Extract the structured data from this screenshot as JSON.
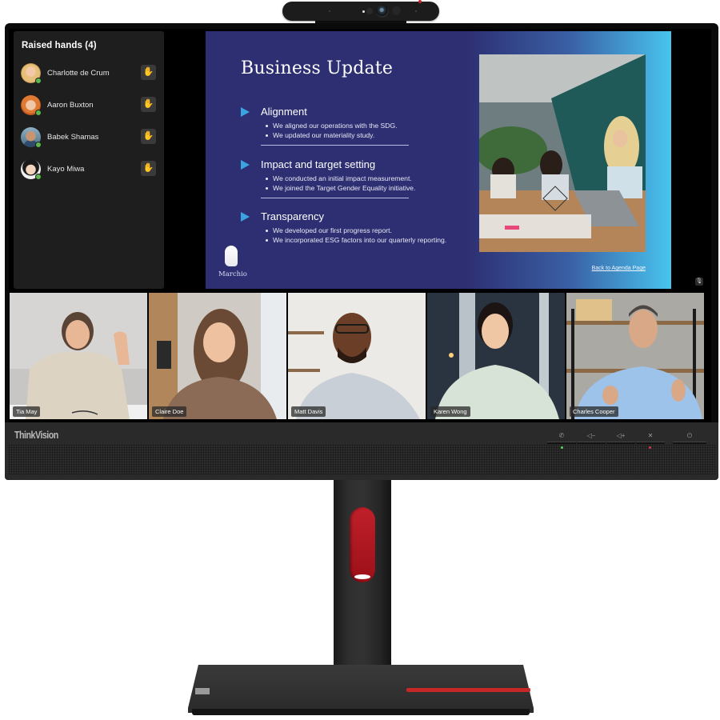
{
  "raised_hands": {
    "title": "Raised hands (4)",
    "participants": [
      {
        "name": "Charlotte de Crum",
        "status": "available",
        "icon": "raised-hand-icon"
      },
      {
        "name": "Aaron Buxton",
        "status": "available",
        "icon": "raised-hand-icon"
      },
      {
        "name": "Babek Shamas",
        "status": "available",
        "icon": "raised-hand-icon"
      },
      {
        "name": "Kayo Miwa",
        "status": "available",
        "icon": "raised-hand-icon"
      }
    ],
    "hand_glyph": "✋"
  },
  "slide": {
    "title": "Business Update",
    "sections": [
      {
        "heading": "Alignment",
        "bullets": [
          "We aligned our operations with the SDG.",
          "We updated our materiality study."
        ]
      },
      {
        "heading": "Impact and target setting",
        "bullets": [
          "We conducted an initial impact measurement.",
          "We joined the Target Gender Equality initiative."
        ]
      },
      {
        "heading": "Transparency",
        "bullets": [
          "We developed our first progress report.",
          "We incorporated ESG factors into our  quarterly reporting."
        ]
      }
    ],
    "logo_text": "Marchio",
    "link": "Back to Agenda Page",
    "colors": {
      "background": "#2d2f72",
      "gradient_end": "#48c4ef",
      "accent": "#3aa3e0"
    }
  },
  "video_tiles": [
    {
      "name": "Tia May"
    },
    {
      "name": "Claire Doe"
    },
    {
      "name": "Matt Davis"
    },
    {
      "name": "Karen Wong"
    },
    {
      "name": "Charles Cooper"
    }
  ],
  "monitor": {
    "brand": "ThinkVision",
    "controls": [
      {
        "name": "call",
        "glyph": "✆"
      },
      {
        "name": "volume-down",
        "glyph": "◁−"
      },
      {
        "name": "volume-up",
        "glyph": "◁+"
      },
      {
        "name": "mute",
        "glyph": "✕"
      },
      {
        "name": "power",
        "glyph": "⏻"
      }
    ],
    "mic_muted_glyph": "🎙"
  }
}
